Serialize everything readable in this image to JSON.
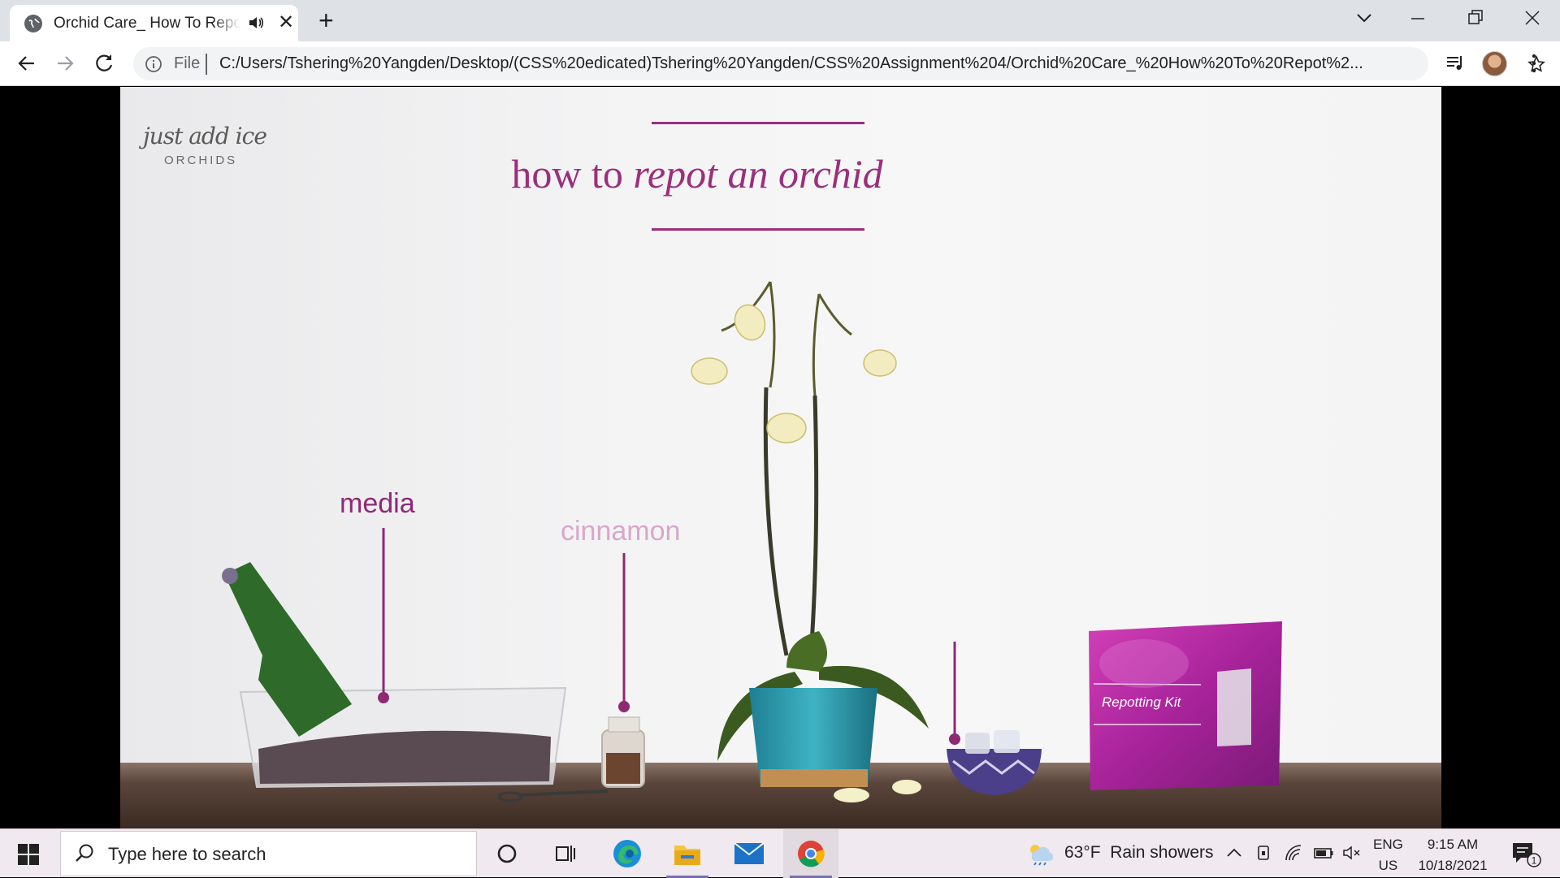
{
  "browser": {
    "tab": {
      "title": "Orchid Care_ How To Repot an Orchid"
    },
    "address": {
      "scheme_label": "File",
      "url": "C:/Users/Tshering%20Yangden/Desktop/(CSS%20edicated)Tshering%20Yangden/CSS%20Assignment%204/Orchid%20Care_%20How%20To%20Repot%2..."
    }
  },
  "video": {
    "brand": {
      "script": "just add ice",
      "sub": "ORCHIDS"
    },
    "title": {
      "part1": "how to ",
      "part2": "repot an orchid"
    },
    "labels": {
      "media": "media",
      "cinnamon": "cinnamon",
      "kit": "Repotting Kit"
    },
    "colors": {
      "accent": "#9b2f7c",
      "cinnamon": "#d9a7c9",
      "kit_box": "#b0279a"
    }
  },
  "taskbar": {
    "search_placeholder": "Type here to search",
    "apps": [
      "cortana",
      "task-view",
      "edge",
      "file-explorer",
      "mail",
      "chrome"
    ],
    "weather": {
      "temp": "63°F",
      "condition": "Rain showers"
    },
    "language": {
      "line1": "ENG",
      "line2": "US"
    },
    "clock": {
      "time": "9:15 AM",
      "date": "10/18/2021"
    },
    "notification_count": "1"
  }
}
